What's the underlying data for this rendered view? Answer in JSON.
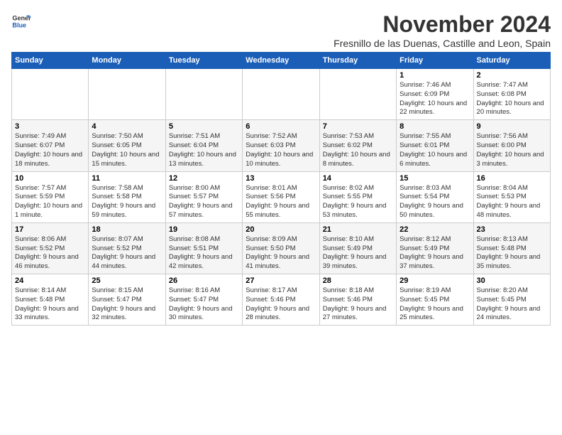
{
  "logo": {
    "line1": "General",
    "line2": "Blue"
  },
  "title": "November 2024",
  "subtitle": "Fresnillo de las Duenas, Castille and Leon, Spain",
  "days_of_week": [
    "Sunday",
    "Monday",
    "Tuesday",
    "Wednesday",
    "Thursday",
    "Friday",
    "Saturday"
  ],
  "weeks": [
    {
      "days": [
        {
          "num": "",
          "info": ""
        },
        {
          "num": "",
          "info": ""
        },
        {
          "num": "",
          "info": ""
        },
        {
          "num": "",
          "info": ""
        },
        {
          "num": "",
          "info": ""
        },
        {
          "num": "1",
          "info": "Sunrise: 7:46 AM\nSunset: 6:09 PM\nDaylight: 10 hours and 22 minutes."
        },
        {
          "num": "2",
          "info": "Sunrise: 7:47 AM\nSunset: 6:08 PM\nDaylight: 10 hours and 20 minutes."
        }
      ]
    },
    {
      "days": [
        {
          "num": "3",
          "info": "Sunrise: 7:49 AM\nSunset: 6:07 PM\nDaylight: 10 hours and 18 minutes."
        },
        {
          "num": "4",
          "info": "Sunrise: 7:50 AM\nSunset: 6:05 PM\nDaylight: 10 hours and 15 minutes."
        },
        {
          "num": "5",
          "info": "Sunrise: 7:51 AM\nSunset: 6:04 PM\nDaylight: 10 hours and 13 minutes."
        },
        {
          "num": "6",
          "info": "Sunrise: 7:52 AM\nSunset: 6:03 PM\nDaylight: 10 hours and 10 minutes."
        },
        {
          "num": "7",
          "info": "Sunrise: 7:53 AM\nSunset: 6:02 PM\nDaylight: 10 hours and 8 minutes."
        },
        {
          "num": "8",
          "info": "Sunrise: 7:55 AM\nSunset: 6:01 PM\nDaylight: 10 hours and 6 minutes."
        },
        {
          "num": "9",
          "info": "Sunrise: 7:56 AM\nSunset: 6:00 PM\nDaylight: 10 hours and 3 minutes."
        }
      ]
    },
    {
      "days": [
        {
          "num": "10",
          "info": "Sunrise: 7:57 AM\nSunset: 5:59 PM\nDaylight: 10 hours and 1 minute."
        },
        {
          "num": "11",
          "info": "Sunrise: 7:58 AM\nSunset: 5:58 PM\nDaylight: 9 hours and 59 minutes."
        },
        {
          "num": "12",
          "info": "Sunrise: 8:00 AM\nSunset: 5:57 PM\nDaylight: 9 hours and 57 minutes."
        },
        {
          "num": "13",
          "info": "Sunrise: 8:01 AM\nSunset: 5:56 PM\nDaylight: 9 hours and 55 minutes."
        },
        {
          "num": "14",
          "info": "Sunrise: 8:02 AM\nSunset: 5:55 PM\nDaylight: 9 hours and 53 minutes."
        },
        {
          "num": "15",
          "info": "Sunrise: 8:03 AM\nSunset: 5:54 PM\nDaylight: 9 hours and 50 minutes."
        },
        {
          "num": "16",
          "info": "Sunrise: 8:04 AM\nSunset: 5:53 PM\nDaylight: 9 hours and 48 minutes."
        }
      ]
    },
    {
      "days": [
        {
          "num": "17",
          "info": "Sunrise: 8:06 AM\nSunset: 5:52 PM\nDaylight: 9 hours and 46 minutes."
        },
        {
          "num": "18",
          "info": "Sunrise: 8:07 AM\nSunset: 5:52 PM\nDaylight: 9 hours and 44 minutes."
        },
        {
          "num": "19",
          "info": "Sunrise: 8:08 AM\nSunset: 5:51 PM\nDaylight: 9 hours and 42 minutes."
        },
        {
          "num": "20",
          "info": "Sunrise: 8:09 AM\nSunset: 5:50 PM\nDaylight: 9 hours and 41 minutes."
        },
        {
          "num": "21",
          "info": "Sunrise: 8:10 AM\nSunset: 5:49 PM\nDaylight: 9 hours and 39 minutes."
        },
        {
          "num": "22",
          "info": "Sunrise: 8:12 AM\nSunset: 5:49 PM\nDaylight: 9 hours and 37 minutes."
        },
        {
          "num": "23",
          "info": "Sunrise: 8:13 AM\nSunset: 5:48 PM\nDaylight: 9 hours and 35 minutes."
        }
      ]
    },
    {
      "days": [
        {
          "num": "24",
          "info": "Sunrise: 8:14 AM\nSunset: 5:48 PM\nDaylight: 9 hours and 33 minutes."
        },
        {
          "num": "25",
          "info": "Sunrise: 8:15 AM\nSunset: 5:47 PM\nDaylight: 9 hours and 32 minutes."
        },
        {
          "num": "26",
          "info": "Sunrise: 8:16 AM\nSunset: 5:47 PM\nDaylight: 9 hours and 30 minutes."
        },
        {
          "num": "27",
          "info": "Sunrise: 8:17 AM\nSunset: 5:46 PM\nDaylight: 9 hours and 28 minutes."
        },
        {
          "num": "28",
          "info": "Sunrise: 8:18 AM\nSunset: 5:46 PM\nDaylight: 9 hours and 27 minutes."
        },
        {
          "num": "29",
          "info": "Sunrise: 8:19 AM\nSunset: 5:45 PM\nDaylight: 9 hours and 25 minutes."
        },
        {
          "num": "30",
          "info": "Sunrise: 8:20 AM\nSunset: 5:45 PM\nDaylight: 9 hours and 24 minutes."
        }
      ]
    }
  ]
}
